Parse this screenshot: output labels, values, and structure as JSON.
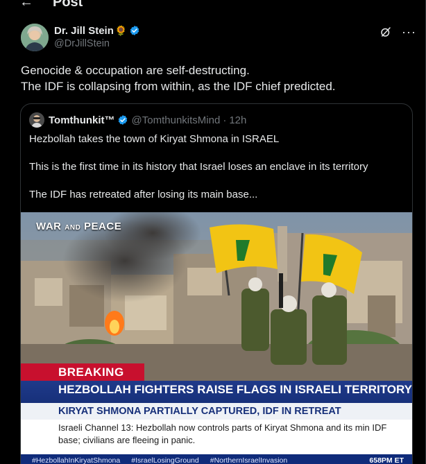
{
  "header": {
    "title": "Post"
  },
  "author": {
    "display_name": "Dr. Jill Stein",
    "handle": "@DrJillStein",
    "badge_emoji": "🌻"
  },
  "tweet": {
    "line1": "Genocide & occupation are self-destructing.",
    "line2": "The IDF is collapsing from within, as the IDF chief predicted."
  },
  "quote": {
    "name": "Tomthunkit™",
    "handle": "@TomthunkitsMind",
    "separator": "·",
    "time": "12h",
    "line1": "Hezbollah takes the town of Kiryat Shmona in ISRAEL",
    "line2": "This is the first time in its history that Israel loses an enclave in its territory",
    "line3": "The IDF has retreated after losing its main base..."
  },
  "media": {
    "brand_main": "WAR",
    "brand_and": "AND",
    "brand_end": "PEACE",
    "breaking": "BREAKING",
    "headline": "HEZBOLLAH FIGHTERS RAISE FLAGS IN ISRAELI TERRITORY",
    "subhead": "KIRYAT SHMONA PARTIALLY CAPTURED, IDF IN RETREAT",
    "info": "Israeli Channel 13: Hezbollah now controls parts of Kiryat Shmona and its min IDF base; civilians are fleeing in panic.",
    "ticker": [
      "#HezbollahInKiryatShmona",
      "#IsraelLosingGround",
      "#NorthernIsraelInvasion"
    ],
    "clock": "658PM ET"
  },
  "colors": {
    "background": "#000000",
    "text": "#e7e9ea",
    "muted": "#71767b",
    "verified": "#1d9bf0",
    "breaking": "#c8102e",
    "lower_third": "#1f3a8a"
  }
}
